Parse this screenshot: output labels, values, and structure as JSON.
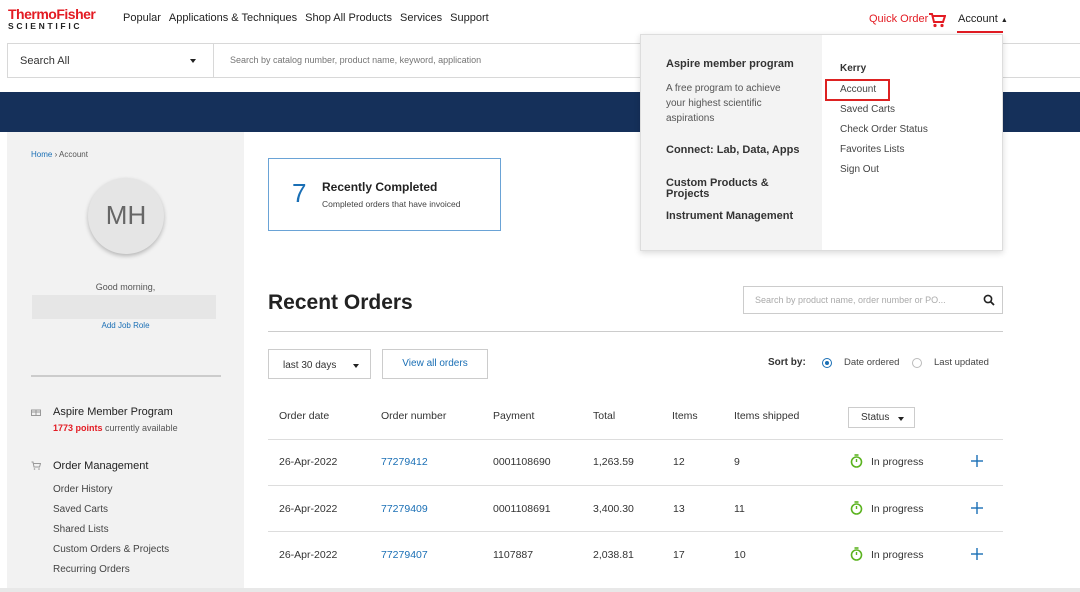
{
  "brand": {
    "logo_top": "ThermoFisher",
    "logo_bottom": "SCIENTIFIC"
  },
  "nav": {
    "items": [
      "Popular",
      "Applications & Techniques",
      "Shop All Products",
      "Services",
      "Support"
    ],
    "quick_order": "Quick Order",
    "account": "Account"
  },
  "search": {
    "category": "Search All",
    "placeholder": "Search by catalog number, product name, keyword, application"
  },
  "sidebar": {
    "breadcrumb": [
      "Home",
      "Account"
    ],
    "initials": "MH",
    "greeting": "Good morning,",
    "add_job_role": "Add Job Role",
    "aspire_title": "Aspire Member Program",
    "points": "1773 points",
    "points_suffix": " currently available",
    "order_mgmt_title": "Order Management",
    "order_links": [
      "Order History",
      "Saved Carts",
      "Shared Lists",
      "Custom Orders & Projects",
      "Recurring Orders"
    ]
  },
  "recent_completed": {
    "count": "7",
    "title": "Recently Completed",
    "subtitle": "Completed orders that have invoiced"
  },
  "recent_orders": {
    "title": "Recent Orders",
    "search_placeholder": "Search by product name, order number or PO...",
    "period": "last 30 days",
    "view_all": "View all orders",
    "sort_by": "Sort by:",
    "sort_options": [
      "Date ordered",
      "Last updated"
    ],
    "sort_selected": "Date ordered",
    "columns": [
      "Order date",
      "Order number",
      "Payment",
      "Total",
      "Items",
      "Items shipped",
      "Status"
    ],
    "rows": [
      {
        "date": "26-Apr-2022",
        "number": "77279412",
        "payment": "0001108690",
        "total": "1,263.59",
        "items": "12",
        "shipped": "9",
        "status": "In progress"
      },
      {
        "date": "26-Apr-2022",
        "number": "77279409",
        "payment": "0001108691",
        "total": "3,400.30",
        "items": "13",
        "shipped": "11",
        "status": "In progress"
      },
      {
        "date": "26-Apr-2022",
        "number": "77279407",
        "payment": "1107887",
        "total": "2,038.81",
        "items": "17",
        "shipped": "10",
        "status": "In progress"
      }
    ]
  },
  "account_menu": {
    "left_headings": [
      "Aspire member program",
      "Connect: Lab, Data, Apps",
      "Custom Products & Projects",
      "Instrument Management"
    ],
    "aspire_desc": "A free program to achieve your highest scientific aspirations",
    "user_name": "Kerry",
    "links": [
      "Account",
      "Saved Carts",
      "Check Order Status",
      "Favorites Lists",
      "Sign Out"
    ],
    "highlighted": "Account"
  },
  "colors": {
    "brand_red": "#e31b23",
    "banner_navy": "#15305a",
    "link_blue": "#1a6fb5",
    "status_green": "#5bb31f"
  }
}
